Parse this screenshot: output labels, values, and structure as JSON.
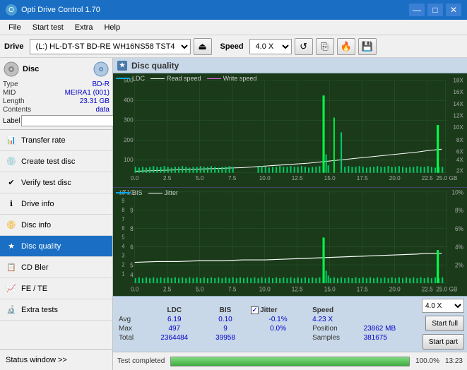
{
  "titleBar": {
    "title": "Opti Drive Control 1.70",
    "minimizeBtn": "—",
    "maximizeBtn": "□",
    "closeBtn": "✕"
  },
  "menuBar": {
    "items": [
      "File",
      "Start test",
      "Extra",
      "Help"
    ]
  },
  "driveToolbar": {
    "driveLabel": "Drive",
    "driveValue": "(L:)  HL-DT-ST BD-RE  WH16NS58 TST4",
    "speedLabel": "Speed",
    "speedValue": "4.0 X",
    "ejectIcon": "⏏",
    "copyIcon": "⎘",
    "settingsIcon": "⚙",
    "saveIcon": "💾"
  },
  "disc": {
    "header": "Disc",
    "type": {
      "label": "Type",
      "value": "BD-R"
    },
    "mid": {
      "label": "MID",
      "value": "MEIRA1 (001)"
    },
    "length": {
      "label": "Length",
      "value": "23.31 GB"
    },
    "contents": {
      "label": "Contents",
      "value": "data"
    },
    "label": {
      "label": "Label",
      "placeholder": ""
    }
  },
  "sidebar": {
    "items": [
      {
        "id": "transfer-rate",
        "label": "Transfer rate",
        "icon": "📊"
      },
      {
        "id": "create-test-disc",
        "label": "Create test disc",
        "icon": "💿"
      },
      {
        "id": "verify-test-disc",
        "label": "Verify test disc",
        "icon": "✔"
      },
      {
        "id": "drive-info",
        "label": "Drive info",
        "icon": "ℹ"
      },
      {
        "id": "disc-info",
        "label": "Disc info",
        "icon": "📀"
      },
      {
        "id": "disc-quality",
        "label": "Disc quality",
        "icon": "★",
        "active": true
      },
      {
        "id": "cd-bler",
        "label": "CD Bler",
        "icon": "📋"
      },
      {
        "id": "fe-te",
        "label": "FE / TE",
        "icon": "📈"
      },
      {
        "id": "extra-tests",
        "label": "Extra tests",
        "icon": "🔬"
      }
    ],
    "statusWindow": "Status window >>"
  },
  "discQuality": {
    "title": "Disc quality",
    "legend1": {
      "ldc": "LDC",
      "readSpeed": "Read speed",
      "writeSpeed": "Write speed"
    },
    "legend2": {
      "bis": "BIS",
      "jitter": "Jitter"
    },
    "chart1": {
      "yMax": 500,
      "yMin": 0,
      "xMax": 25,
      "xMin": 0,
      "rightLabels": [
        "18X",
        "16X",
        "14X",
        "12X",
        "10X",
        "8X",
        "6X",
        "4X",
        "2X"
      ],
      "xTicks": [
        0,
        2.5,
        5.0,
        7.5,
        10.0,
        12.5,
        15.0,
        17.5,
        20.0,
        22.5,
        25.0
      ],
      "yTicks": [
        0,
        100,
        200,
        300,
        400,
        500
      ]
    },
    "chart2": {
      "yMax": 10,
      "yMin": 0,
      "xMax": 25,
      "xMin": 0,
      "rightLabels": [
        "10%",
        "8%",
        "6%",
        "4%",
        "2%"
      ],
      "xTicks": [
        0,
        2.5,
        5.0,
        7.5,
        10.0,
        12.5,
        15.0,
        17.5,
        20.0,
        22.5,
        25.0
      ],
      "yTicks": [
        0,
        2,
        4,
        6,
        8,
        10
      ]
    }
  },
  "stats": {
    "headers": [
      "",
      "LDC",
      "BIS",
      "",
      "Jitter",
      "Speed",
      ""
    ],
    "avg": {
      "label": "Avg",
      "ldc": "6.19",
      "bis": "0.10",
      "jitter": "-0.1%"
    },
    "max": {
      "label": "Max",
      "ldc": "497",
      "bis": "9",
      "jitter": "0.0%"
    },
    "total": {
      "label": "Total",
      "ldc": "2364484",
      "bis": "39958",
      "jitter": ""
    },
    "jitterChecked": true,
    "jitterLabel": "Jitter",
    "speed": {
      "label": "Speed",
      "value": "4.23 X"
    },
    "speedDropdown": "4.0 X",
    "position": {
      "label": "Position",
      "value": "23862 MB"
    },
    "samples": {
      "label": "Samples",
      "value": "381675"
    },
    "startFullBtn": "Start full",
    "startPartBtn": "Start part"
  },
  "progress": {
    "fillPercent": 100,
    "text": "100.0%",
    "statusText": "Test completed",
    "time": "13:23"
  },
  "colors": {
    "accent": "#1a6fc4",
    "sidebarBg": "#f0f0f0",
    "chartBg": "#1a3a1a",
    "ldcColor": "#00aaff",
    "bisColor": "#00aaff",
    "readSpeedColor": "#ffffff",
    "writeSpeedColor": "#ff66ff",
    "jitterColor": "#ffffff",
    "greenBar": "#00dd00"
  }
}
